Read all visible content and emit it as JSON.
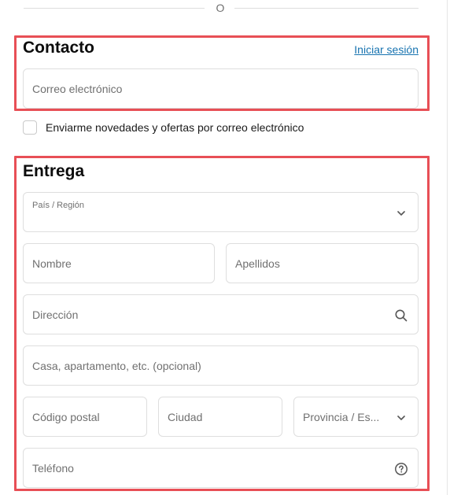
{
  "divider": {
    "text": "O"
  },
  "contact": {
    "title": "Contacto",
    "login_link": "Iniciar sesión",
    "email_placeholder": "Correo electrónico"
  },
  "newsletter": {
    "checked": false,
    "label": "Enviarme novedades y ofertas por correo electrónico"
  },
  "delivery": {
    "title": "Entrega",
    "country_label": "País / Región",
    "country_value": "",
    "first_name_placeholder": "Nombre",
    "last_name_placeholder": "Apellidos",
    "address_placeholder": "Dirección",
    "apartment_placeholder": "Casa, apartamento, etc. (opcional)",
    "postal_code_placeholder": "Código postal",
    "city_placeholder": "Ciudad",
    "province_placeholder": "Provincia / Es...",
    "phone_placeholder": "Teléfono"
  },
  "icons": {
    "chevron": "chevron-down-icon",
    "search": "search-icon",
    "help": "help-circle-icon"
  },
  "colors": {
    "highlight": "#e84f56",
    "link": "#1773b0",
    "border": "#dedede",
    "placeholder": "#707070"
  }
}
